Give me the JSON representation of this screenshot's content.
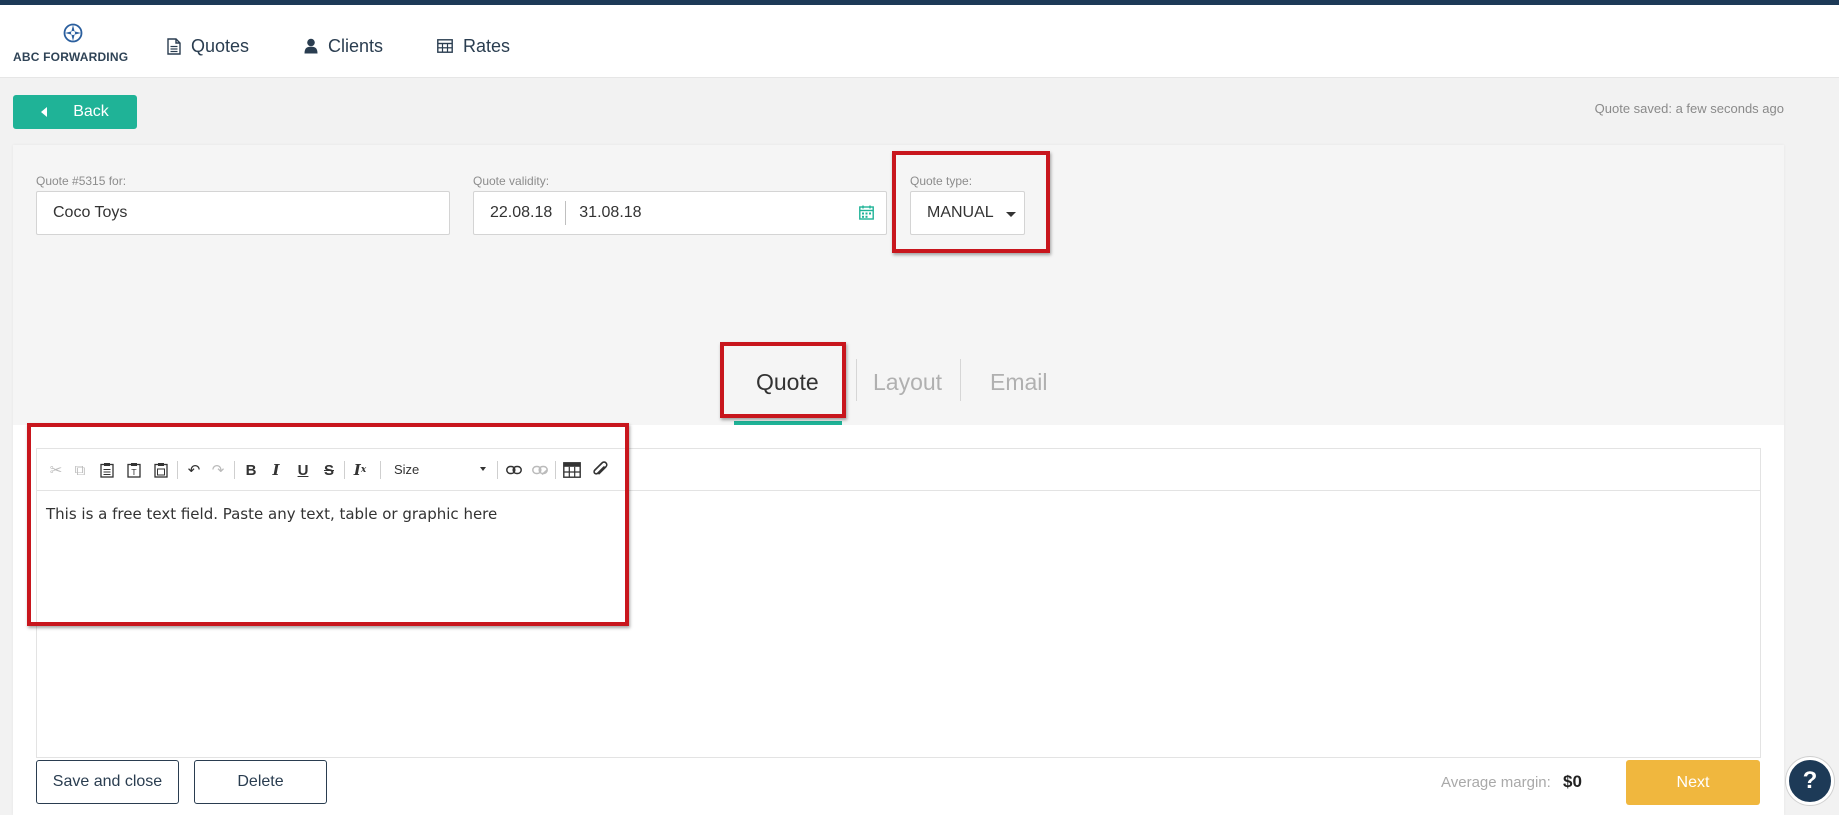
{
  "brand": {
    "name": "ABC FORWARDING",
    "logo_icon": "compass-icon"
  },
  "nav": {
    "items": [
      {
        "label": "Quotes",
        "icon": "document-icon"
      },
      {
        "label": "Clients",
        "icon": "user-icon"
      },
      {
        "label": "Rates",
        "icon": "table-icon"
      }
    ]
  },
  "toolbar_top": {
    "back_label": "Back",
    "saved_status": "Quote saved: a few seconds ago"
  },
  "form": {
    "client_label": "Quote #5315 for:",
    "client_value": "Coco Toys",
    "validity_label": "Quote validity:",
    "validity_from": "22.08.18",
    "validity_to": "31.08.18",
    "type_label": "Quote type:",
    "type_value": "MANUAL"
  },
  "tabs": [
    {
      "label": "Quote",
      "active": true
    },
    {
      "label": "Layout",
      "active": false
    },
    {
      "label": "Email",
      "active": false
    }
  ],
  "editor": {
    "size_label": "Size",
    "content": "This is a free text field. Paste any text, table or graphic here"
  },
  "footer": {
    "save_close_label": "Save and close",
    "delete_label": "Delete",
    "avg_margin_label": "Average margin:",
    "avg_margin_value": "$0",
    "next_label": "Next",
    "help_label": "?"
  },
  "colors": {
    "accent": "#1fb397",
    "navy": "#1d3a57",
    "next": "#f0b73e",
    "highlight": "#c8161d"
  }
}
